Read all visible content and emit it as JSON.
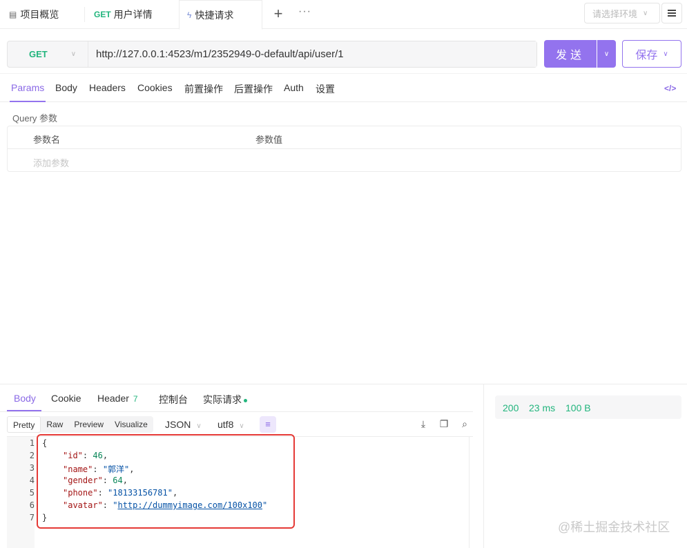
{
  "tabs": [
    {
      "label": "项目概览",
      "icon": "layout-icon"
    },
    {
      "method": "GET",
      "label": "用户详情"
    },
    {
      "label": "快捷请求",
      "icon": "lightning-icon"
    }
  ],
  "tab_actions": {
    "plus": "+",
    "more": "···"
  },
  "env_select": {
    "placeholder": "请选择环境"
  },
  "request": {
    "method": "GET",
    "url": "http://127.0.0.1:4523/m1/2352949-0-default/api/user/1",
    "send_label": "发送",
    "save_label": "保存"
  },
  "request_tabs": [
    "Params",
    "Body",
    "Headers",
    "Cookies",
    "前置操作",
    "后置操作",
    "Auth",
    "设置"
  ],
  "query": {
    "label": "Query 参数",
    "col_name": "参数名",
    "col_value": "参数值",
    "add_placeholder": "添加参数"
  },
  "response_tabs": {
    "body": "Body",
    "cookie": "Cookie",
    "header": "Header",
    "header_count": "7",
    "console": "控制台",
    "actual": "实际请求"
  },
  "status": {
    "code": "200",
    "time": "23 ms",
    "size": "100 B"
  },
  "view_modes": [
    "Pretty",
    "Raw",
    "Preview",
    "Visualize"
  ],
  "format": "JSON",
  "encoding": "utf8",
  "response_body": {
    "line_numbers": [
      "1",
      "2",
      "3",
      "4",
      "5",
      "6",
      "7"
    ],
    "open": "{",
    "close": "}",
    "fields": [
      {
        "key": "\"id\"",
        "value": "46",
        "type": "number"
      },
      {
        "key": "\"name\"",
        "value": "\"郭洋\"",
        "type": "string"
      },
      {
        "key": "\"gender\"",
        "value": "64",
        "type": "number"
      },
      {
        "key": "\"phone\"",
        "value": "\"18133156781\"",
        "type": "string"
      },
      {
        "key": "\"avatar\"",
        "value": "http://dummyimage.com/100x100",
        "type": "link"
      }
    ]
  },
  "watermark": "@稀土掘金技术社区",
  "colors": {
    "accent": "#9373ee",
    "success": "#22b57d",
    "highlight": "#e53935"
  }
}
